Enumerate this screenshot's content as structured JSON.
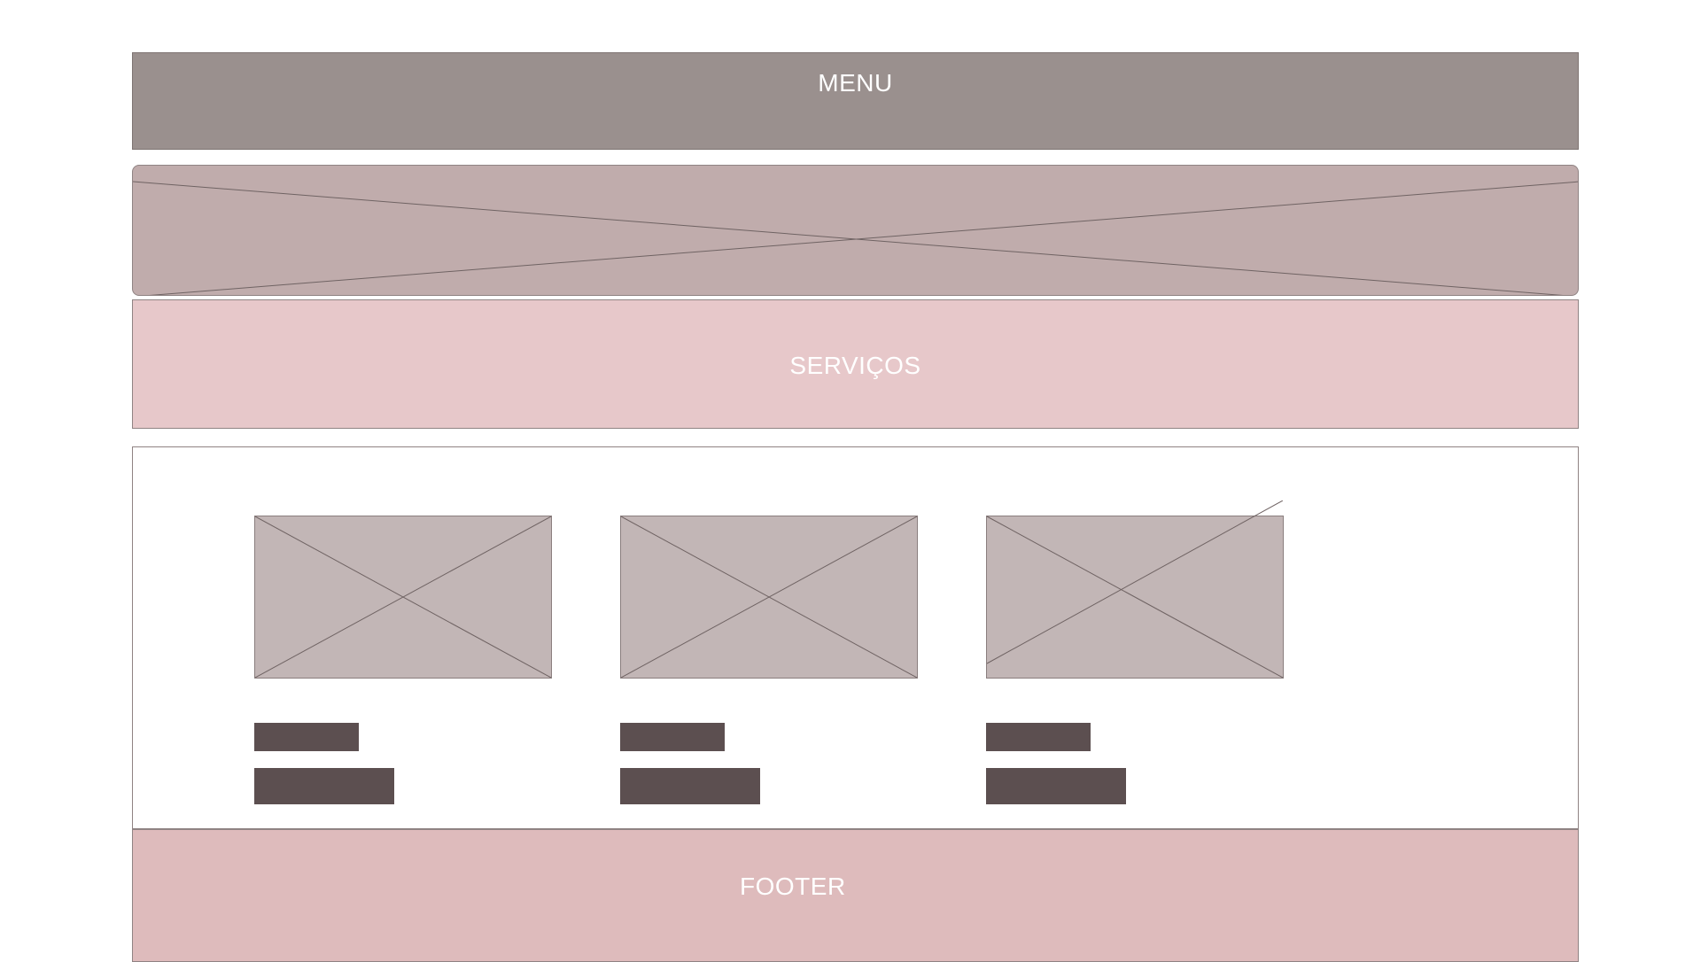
{
  "menu": {
    "label": "MENU"
  },
  "services": {
    "label": "SERVIÇOS"
  },
  "footer": {
    "label": "FOOTER"
  },
  "colors": {
    "menu_bg": "#9a908e",
    "hero_bg": "#c0acac",
    "services_bg": "#e7c8ca",
    "placeholder_bg": "#c2b6b6",
    "text_bar": "#5c4f50",
    "footer_bg": "#debbbc"
  }
}
